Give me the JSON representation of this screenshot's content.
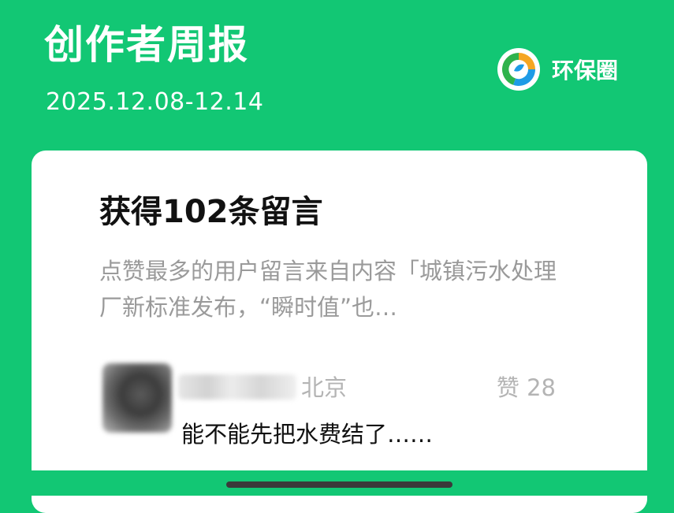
{
  "header": {
    "title": "创作者周报",
    "date_range": "2025.12.08-12.14",
    "brand_name": "环保圈",
    "brand_icon": "recycle-leaf-logo"
  },
  "card": {
    "title": "获得102条留言",
    "description": "点赞最多的用户留言来自内容「城镇污水处理厂新标准发布，“瞬时值”也…",
    "comment": {
      "location": "北京",
      "likes_label": "赞 28",
      "text": "能不能先把水费结了……"
    }
  },
  "colors": {
    "background": "#12c774",
    "card": "#ffffff",
    "muted_text": "#9a9a9a"
  }
}
